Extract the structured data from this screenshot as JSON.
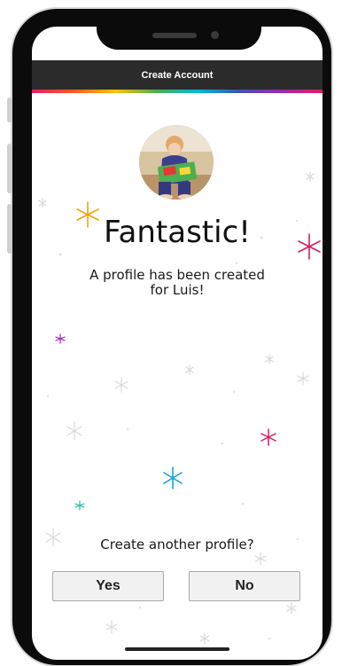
{
  "header": {
    "title": "Create Account"
  },
  "main": {
    "heading": "Fantastic!",
    "message_line1": "A profile has been created",
    "message_line2": "for Luis!",
    "question": "Create another profile?"
  },
  "actions": {
    "yes_label": "Yes",
    "no_label": "No"
  },
  "colors": {
    "header_bg": "#2b2b2b",
    "button_bg": "#f1f1f1",
    "sparkle_gold": "#f0a500",
    "sparkle_magenta": "#d81b60",
    "sparkle_blue": "#1aa0d8",
    "sparkle_teal": "#29b6a6",
    "sparkle_purple": "#a020c8"
  }
}
